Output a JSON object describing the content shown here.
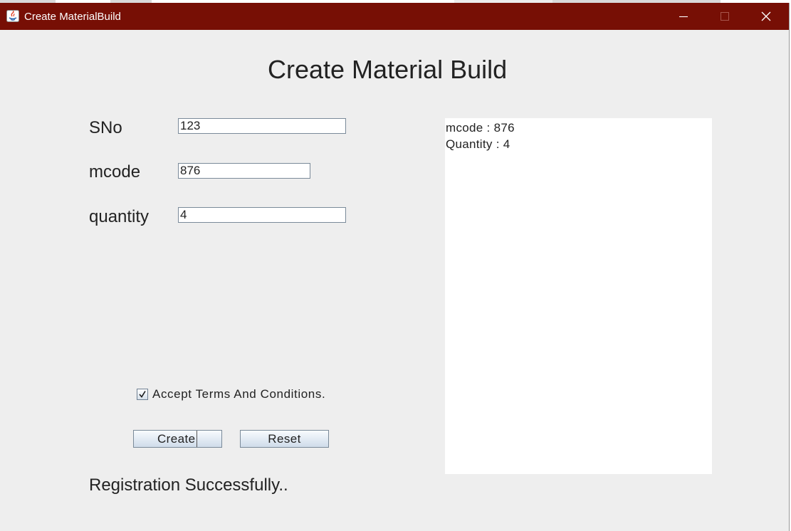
{
  "window": {
    "title": "Create MaterialBuild",
    "titlebar_color": "#770f05",
    "controls": [
      "minimize-icon",
      "maximize-icon",
      "close-icon"
    ]
  },
  "form": {
    "heading": "Create Material Build",
    "fields": {
      "sno": {
        "label": "SNo",
        "value": "123"
      },
      "mcode": {
        "label": "mcode",
        "value": "876"
      },
      "quantity": {
        "label": "quantity",
        "value": "4"
      }
    },
    "terms": {
      "label": "Accept Terms And Conditions.",
      "checked": true
    },
    "buttons": {
      "create": "Create",
      "reset": "Reset"
    },
    "status": "Registration Successfully.."
  },
  "output": {
    "lines": [
      "mcode : 876",
      "Quantity : 4"
    ]
  }
}
